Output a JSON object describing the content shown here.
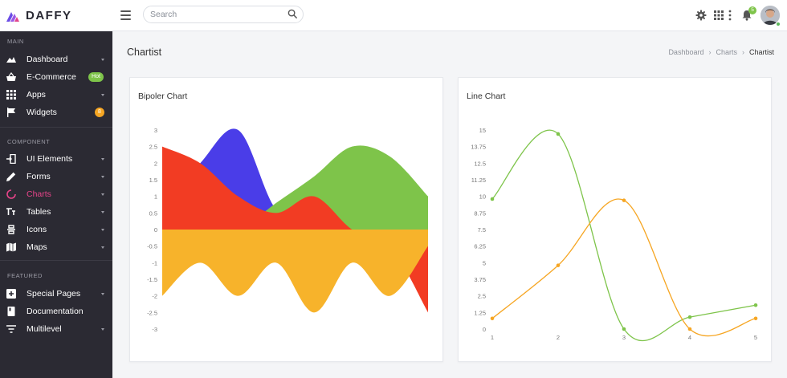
{
  "app": {
    "name": "DAFFY"
  },
  "colors": {
    "accent": "#e8448a",
    "sidebar_bg": "#2b2a33",
    "green": "#7ec44a",
    "orange": "#f6a623",
    "red": "#f23c23",
    "blue": "#4a3de8",
    "gold": "#f7b32b"
  },
  "header": {
    "search_placeholder": "Search",
    "notification_count": "5",
    "icons": [
      "menu-icon",
      "search-icon",
      "gear-icon",
      "apps-grid-icon",
      "more-vertical-icon",
      "bell-icon"
    ]
  },
  "sidebar": {
    "sections": [
      {
        "title": "MAIN",
        "items": [
          {
            "label": "Dashboard",
            "icon": "dashboard-icon",
            "caret": true
          },
          {
            "label": "E-Commerce",
            "icon": "basket-icon",
            "badge": "Hot"
          },
          {
            "label": "Apps",
            "icon": "apps-icon",
            "caret": true
          },
          {
            "label": "Widgets",
            "icon": "flag-icon",
            "count": "8"
          }
        ]
      },
      {
        "title": "COMPONENT",
        "items": [
          {
            "label": "UI Elements",
            "icon": "login-icon",
            "caret": true
          },
          {
            "label": "Forms",
            "icon": "pencil-icon",
            "caret": true
          },
          {
            "label": "Charts",
            "icon": "chart-ring-icon",
            "caret": true,
            "active": true
          },
          {
            "label": "Tables",
            "icon": "table-icon",
            "caret": true
          },
          {
            "label": "Icons",
            "icon": "icons-icon",
            "caret": true
          },
          {
            "label": "Maps",
            "icon": "map-icon",
            "caret": true
          }
        ]
      },
      {
        "title": "FEATURED",
        "items": [
          {
            "label": "Special Pages",
            "icon": "plus-box-icon",
            "caret": true
          },
          {
            "label": "Documentation",
            "icon": "book-icon"
          },
          {
            "label": "Multilevel",
            "icon": "filter-icon",
            "caret": true
          }
        ]
      }
    ]
  },
  "page": {
    "title": "Chartist",
    "breadcrumb": [
      "Dashboard",
      "Charts",
      "Chartist"
    ]
  },
  "chart_data": [
    {
      "type": "area",
      "title": "Bipoler Chart",
      "x": [
        1,
        2,
        3,
        4,
        5,
        6,
        7,
        8
      ],
      "ylim": [
        -3,
        3
      ],
      "yticks": [
        "3",
        "2.5",
        "2",
        "1.5",
        "1",
        "0.5",
        "0",
        "-0.5",
        "-1",
        "-1.5",
        "-2",
        "-2.5",
        "-3"
      ],
      "series": [
        {
          "color": "#4a3de8",
          "values": [
            0.6,
            2.0,
            3.0,
            0.6,
            0.3,
            0.0,
            -0.3,
            -1.0
          ]
        },
        {
          "color": "#7ec44a",
          "values": [
            0.0,
            0.0,
            0.0,
            0.8,
            1.6,
            2.5,
            2.2,
            1.0
          ]
        },
        {
          "color": "#f23c23",
          "values": [
            2.5,
            2.0,
            1.0,
            0.5,
            1.0,
            0.0,
            -0.5,
            -2.5
          ]
        },
        {
          "color": "#f7b32b",
          "values": [
            -2.0,
            -1.0,
            -2.0,
            -1.0,
            -2.5,
            -1.0,
            -2.0,
            -0.5
          ]
        }
      ],
      "grid": false
    },
    {
      "type": "line",
      "title": "Line Chart",
      "x": [
        1,
        2,
        3,
        4,
        5
      ],
      "xticks": [
        "1",
        "2",
        "3",
        "4",
        "5"
      ],
      "ylim": [
        0,
        15
      ],
      "yticks": [
        "15",
        "13.75",
        "12.5",
        "11.25",
        "10",
        "8.75",
        "7.5",
        "6.25",
        "5",
        "3.75",
        "2.5",
        "1.25",
        "0"
      ],
      "series": [
        {
          "color": "#7ec44a",
          "values": [
            9.8,
            14.7,
            0.0,
            0.9,
            1.8
          ]
        },
        {
          "color": "#f6a623",
          "values": [
            0.8,
            4.8,
            9.7,
            0.0,
            0.8
          ]
        }
      ],
      "grid": false
    }
  ]
}
